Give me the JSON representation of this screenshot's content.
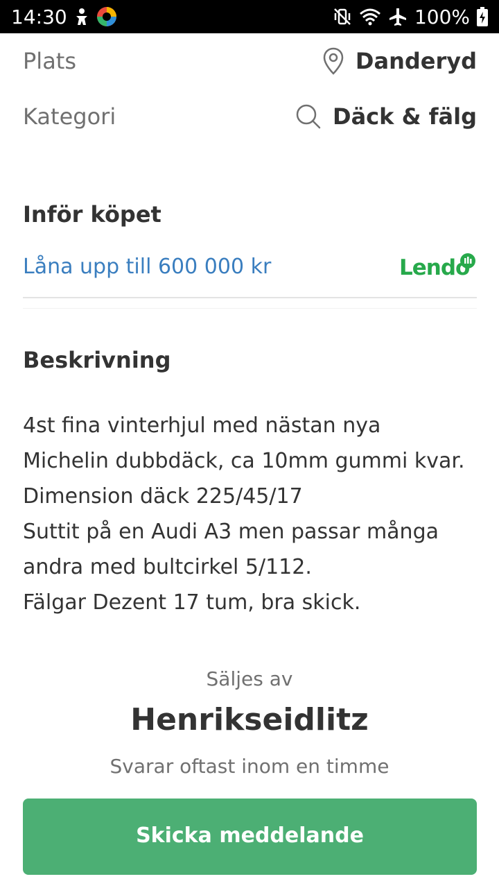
{
  "status_bar": {
    "time": "14:30",
    "battery": "100%"
  },
  "details": {
    "location": {
      "label": "Plats",
      "value": "Danderyd",
      "icon": "location-pin-icon"
    },
    "category": {
      "label": "Kategori",
      "value": "Däck & fälg",
      "icon": "search-icon"
    }
  },
  "before_purchase": {
    "title": "Inför köpet",
    "loan_link": "Låna upp till 600 000 kr",
    "partner": "Lendo"
  },
  "description": {
    "title": "Beskrivning",
    "lines": [
      "4st fina vinterhjul med nästan nya",
      "Michelin dubbdäck, ca 10mm gummi kvar.",
      "Dimension däck 225/45/17",
      "Suttit på en Audi A3 men passar många",
      "andra med bultcirkel 5/112.",
      "Fälgar Dezent 17 tum, bra skick."
    ]
  },
  "seller": {
    "caption": "Säljes av",
    "name": "Henrikseidlitz",
    "response_time": "Svarar oftast inom en timme"
  },
  "actions": {
    "send_message": "Skicka meddelande"
  },
  "colors": {
    "accent_green": "#4caf74",
    "link_blue": "#3a7ebf",
    "lendo_green": "#27a94b"
  }
}
